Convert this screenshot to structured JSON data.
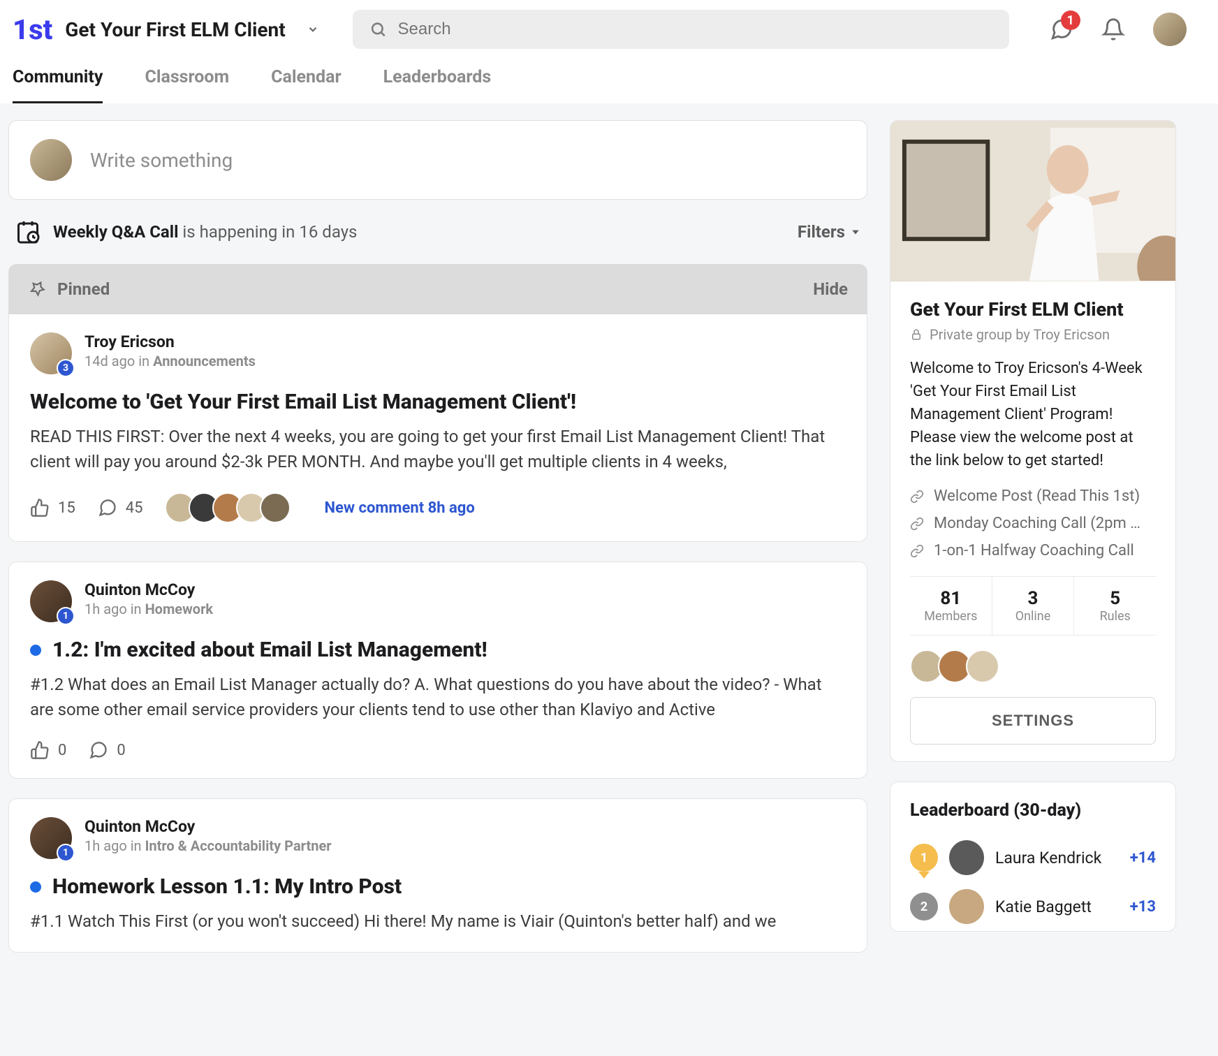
{
  "header": {
    "logo_text": "1st",
    "group_name": "Get Your First ELM Client",
    "search_placeholder": "Search",
    "chat_badge": "1"
  },
  "nav": {
    "tabs": [
      "Community",
      "Classroom",
      "Calendar",
      "Leaderboards"
    ],
    "active": 0
  },
  "compose": {
    "placeholder": "Write something"
  },
  "event": {
    "title": "Weekly Q&A Call",
    "suffix": "is happening in 16 days",
    "filters_label": "Filters"
  },
  "pinned": {
    "label": "Pinned",
    "hide_label": "Hide"
  },
  "posts": [
    {
      "author": "Troy Ericson",
      "level": "3",
      "time": "14d ago in ",
      "category": "Announcements",
      "title": "Welcome to 'Get Your First Email List Management Client'!",
      "body": "READ THIS FIRST: Over the next 4 weeks, you are going to get your first Email List Management Client! That client will pay you around $2-3k PER MONTH. And maybe you'll get multiple clients in 4 weeks,",
      "likes": "15",
      "comments": "45",
      "new_comment": "New comment 8h ago",
      "has_blue_dot": false,
      "pinned": true,
      "show_commenters": true
    },
    {
      "author": "Quinton McCoy",
      "level": "1",
      "time": "1h ago in ",
      "category": "Homework",
      "title": "1.2: I'm excited about Email List Management!",
      "body": "#1.2 What does an Email List Manager actually do? A. What questions do you have about the video? - What are some other email service providers your clients tend to use other than Klaviyo and Active",
      "likes": "0",
      "comments": "0",
      "new_comment": "",
      "has_blue_dot": true,
      "pinned": false,
      "show_commenters": false
    },
    {
      "author": "Quinton McCoy",
      "level": "1",
      "time": "1h ago in ",
      "category": "Intro & Accountability Partner",
      "title": "Homework Lesson 1.1: My Intro Post",
      "body": "#1.1 Watch This First (or you won't succeed) Hi there! My name is Viair (Quinton's better half) and we",
      "likes": "",
      "comments": "",
      "new_comment": "",
      "has_blue_dot": true,
      "pinned": false,
      "show_commenters": false,
      "truncated": true
    }
  ],
  "sidebar_group": {
    "title": "Get Your First ELM Client",
    "private_label": "Private group by Troy Ericson",
    "description": "Welcome to Troy Ericson's 4-Week 'Get Your First Email List Management Client' Program! Please view the welcome post at the link below to get started!",
    "links": [
      "Welcome Post (Read This 1st)",
      "Monday Coaching Call (2pm …",
      "1-on-1 Halfway Coaching Call"
    ],
    "stats": [
      {
        "num": "81",
        "label": "Members"
      },
      {
        "num": "3",
        "label": "Online"
      },
      {
        "num": "5",
        "label": "Rules"
      }
    ],
    "settings_label": "SETTINGS"
  },
  "leaderboard": {
    "title": "Leaderboard (30-day)",
    "rows": [
      {
        "rank": "1",
        "name": "Laura Kendrick",
        "score": "+14",
        "medal": "gold"
      },
      {
        "rank": "2",
        "name": "Katie Baggett",
        "score": "+13",
        "medal": "silver"
      }
    ]
  },
  "commenter_colors": [
    "#c9b897",
    "#3a3a3a",
    "#b47b4a",
    "#d8c9ad",
    "#7a6b52"
  ]
}
